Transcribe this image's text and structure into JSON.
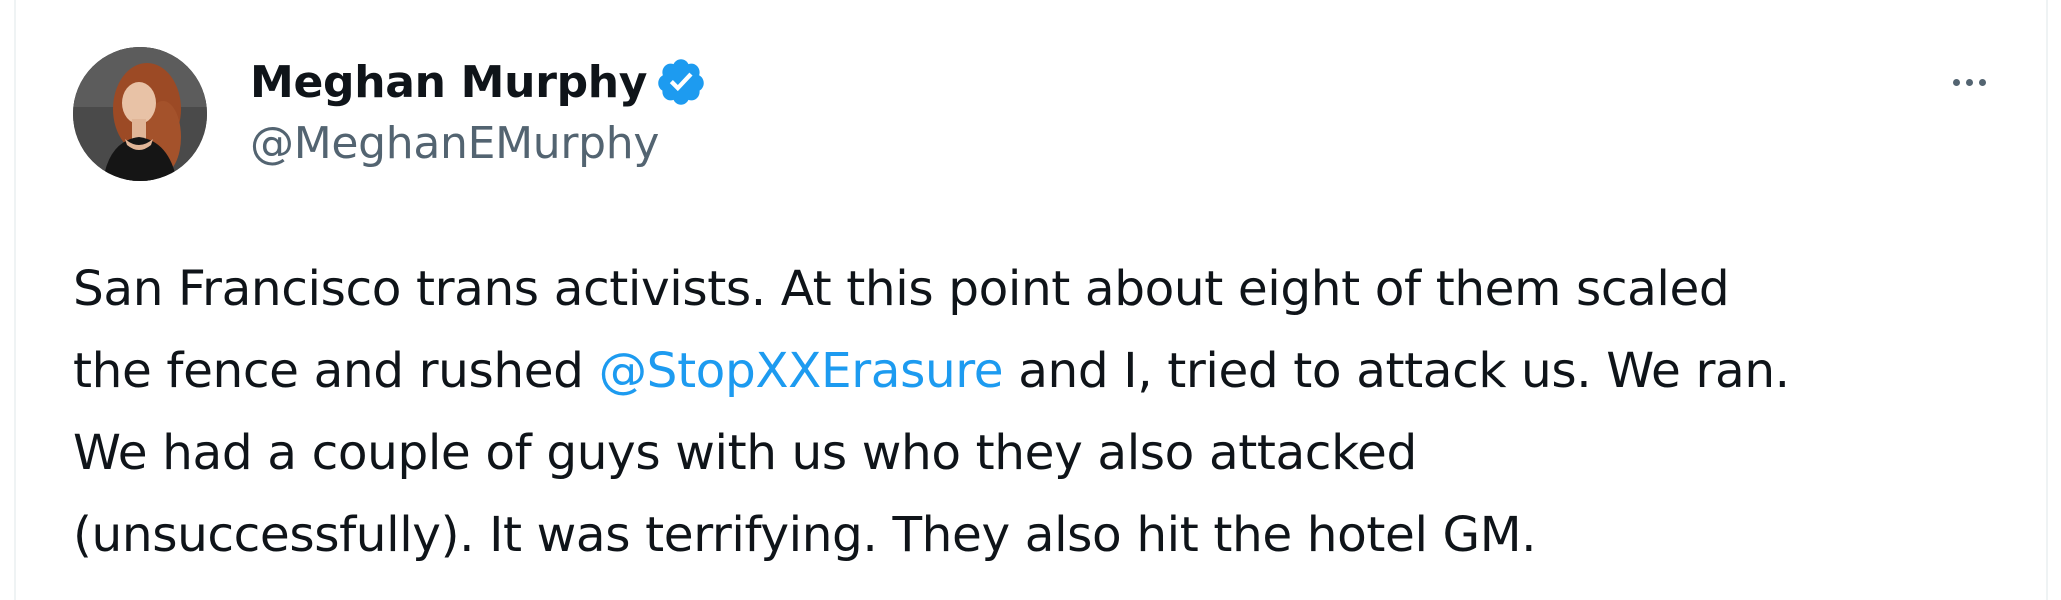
{
  "author": {
    "display_name": "Meghan Murphy",
    "handle": "@MeghanEMurphy",
    "verified": true,
    "avatar": "profile-photo"
  },
  "menu": {
    "icon": "more-options-icon"
  },
  "tweet": {
    "line1": "San Francisco trans activists. At this point about eight of them scaled",
    "line2_before": "the fence and rushed ",
    "mention": "@StopXXErasure",
    "line2_after": " and I, tried to attack us. We ran.",
    "line3": "We had a couple of guys with us who they also attacked",
    "line4": "(unsuccessfully). It was terrifying. They also hit the hotel GM."
  },
  "colors": {
    "verified_badge": "#1d9bf0",
    "mention": "#1d9bf0",
    "handle": "#536471",
    "text": "#0f1419"
  }
}
